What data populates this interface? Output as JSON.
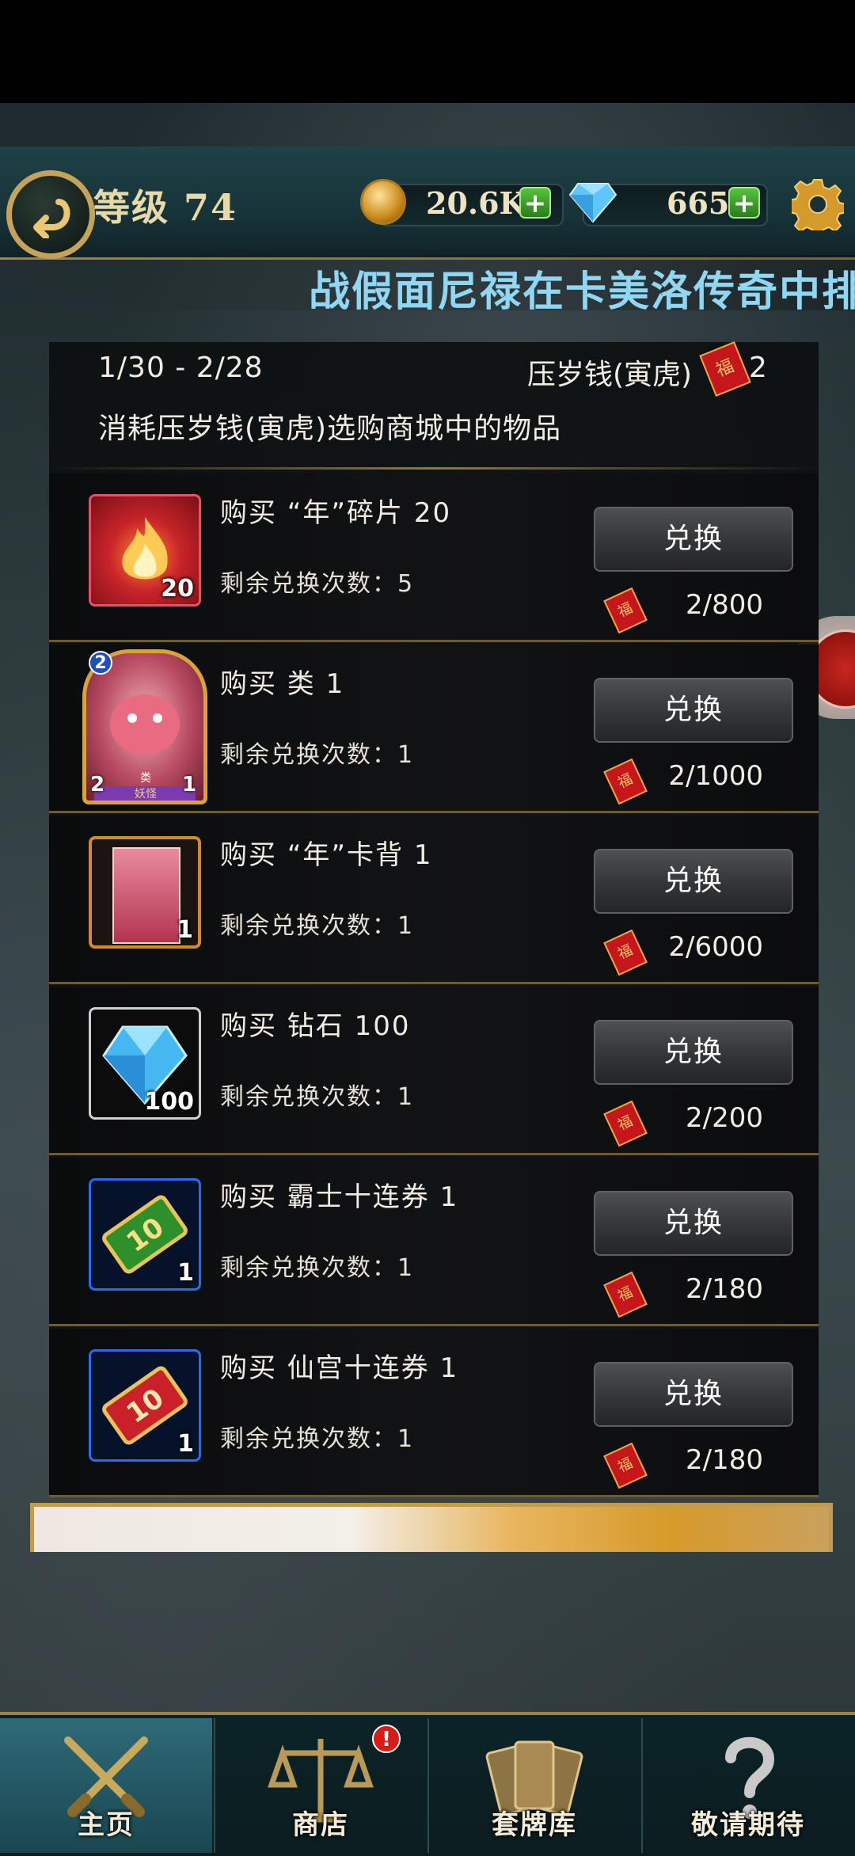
{
  "header": {
    "level_label": "等级 74",
    "gold": "20.6K",
    "gems": "665",
    "plus_label": "+"
  },
  "marquee": {
    "text": "战假面尼禄在卡美洛传奇中排"
  },
  "event": {
    "date_range": "1/30 - 2/28",
    "currency_name": "压岁钱(寅虎)",
    "currency_count": "2",
    "hongbao_glyph": "福",
    "description": "消耗压岁钱(寅虎)选购商城中的物品"
  },
  "items": [
    {
      "title": "购买 “年”碎片 20",
      "remaining": "剩余兑换次数：5",
      "button": "兑换",
      "cost": "2/800",
      "qty": "20"
    },
    {
      "title": "购买 类 1",
      "remaining": "剩余兑换次数：1",
      "button": "兑换",
      "cost": "2/1000",
      "qty": ""
    },
    {
      "title": "购买 “年”卡背 1",
      "remaining": "剩余兑换次数：1",
      "button": "兑换",
      "cost": "2/6000",
      "qty": "1"
    },
    {
      "title": "购买 钻石  100",
      "remaining": "剩余兑换次数：1",
      "button": "兑换",
      "cost": "2/200",
      "qty": "100"
    },
    {
      "title": "购买 霸士十连券  1",
      "remaining": "剩余兑换次数：1",
      "button": "兑换",
      "cost": "2/180",
      "qty": "1"
    },
    {
      "title": "购买 仙宫十连券  1",
      "remaining": "剩余兑换次数：1",
      "button": "兑换",
      "cost": "2/180",
      "qty": "1"
    }
  ],
  "card": {
    "cost": "2",
    "attack": "2",
    "health": "1",
    "name": "类",
    "type": "妖怪"
  },
  "nav": {
    "tabs": [
      {
        "label": "主页",
        "icon": "crossed-swords-icon"
      },
      {
        "label": "商店",
        "icon": "scales-icon"
      },
      {
        "label": "套牌库",
        "icon": "card-deck-icon"
      },
      {
        "label": "敬请期待",
        "icon": "question-mark-icon"
      }
    ],
    "shop_badge": "!"
  },
  "colors": {
    "accent_gold": "#c6a35b",
    "marquee": "#8fd7f2",
    "hongbao_red": "#c5161b",
    "nav_active": "#2f6a78"
  }
}
